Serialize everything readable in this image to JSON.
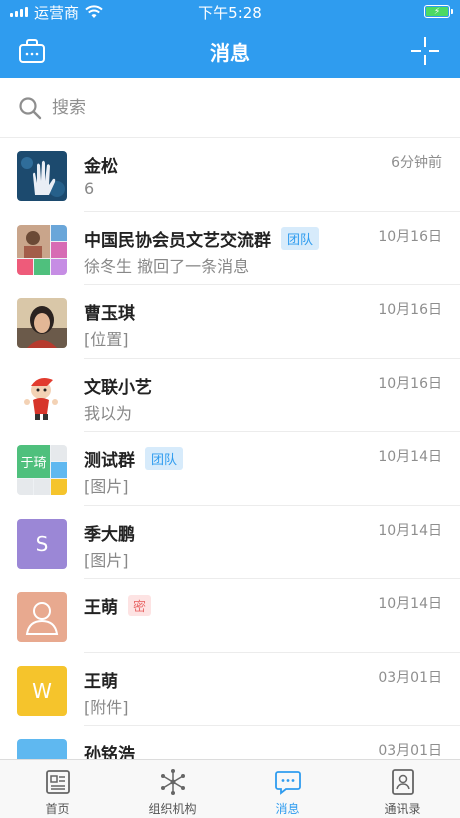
{
  "status_bar": {
    "carrier": "运营商",
    "time": "下午5:28"
  },
  "header": {
    "title": "消息"
  },
  "search": {
    "placeholder": "搜索"
  },
  "messages": [
    {
      "name": "金松",
      "preview": "6",
      "time": "6分钟前",
      "tag": "",
      "avatar_type": "photo-hand"
    },
    {
      "name": "中国民协会员文艺交流群",
      "preview": "徐冬生 撤回了一条消息",
      "time": "10月16日",
      "tag": "团队",
      "avatar_type": "group-grid"
    },
    {
      "name": "曹玉琪",
      "preview": "[位置]",
      "time": "10月16日",
      "tag": "",
      "avatar_type": "photo-woman"
    },
    {
      "name": "文联小艺",
      "preview": "我以为",
      "time": "10月16日",
      "tag": "",
      "avatar_type": "mascot"
    },
    {
      "name": "测试群",
      "preview": "[图片]",
      "time": "10月14日",
      "tag": "团队",
      "avatar_type": "group-grid-2",
      "avatar_text": "于琦"
    },
    {
      "name": "季大鹏",
      "preview": "[图片]",
      "time": "10月14日",
      "tag": "",
      "avatar_type": "letter",
      "avatar_letter": "S",
      "avatar_color": "#9b87d6"
    },
    {
      "name": "王萌",
      "preview": "",
      "time": "10月14日",
      "tag": "密",
      "avatar_type": "default-person",
      "avatar_color": "#e8a98f"
    },
    {
      "name": "王萌",
      "preview": "[附件]",
      "time": "03月01日",
      "tag": "",
      "avatar_type": "letter",
      "avatar_letter": "W",
      "avatar_color": "#f5c42c"
    },
    {
      "name": "孙铭浩",
      "preview": "",
      "time": "03月01日",
      "tag": "",
      "avatar_type": "letter",
      "avatar_letter": "",
      "avatar_color": "#5fb8f0"
    }
  ],
  "tabbar": {
    "tabs": [
      {
        "label": "首页",
        "icon": "home-icon"
      },
      {
        "label": "组织机构",
        "icon": "organization-icon"
      },
      {
        "label": "消息",
        "icon": "message-icon",
        "active": true
      },
      {
        "label": "通讯录",
        "icon": "contacts-icon"
      }
    ]
  },
  "colors": {
    "primary": "#2f9cef",
    "tag_team_bg": "#d7ebfb",
    "tag_secret_bg": "#fde3e3"
  }
}
